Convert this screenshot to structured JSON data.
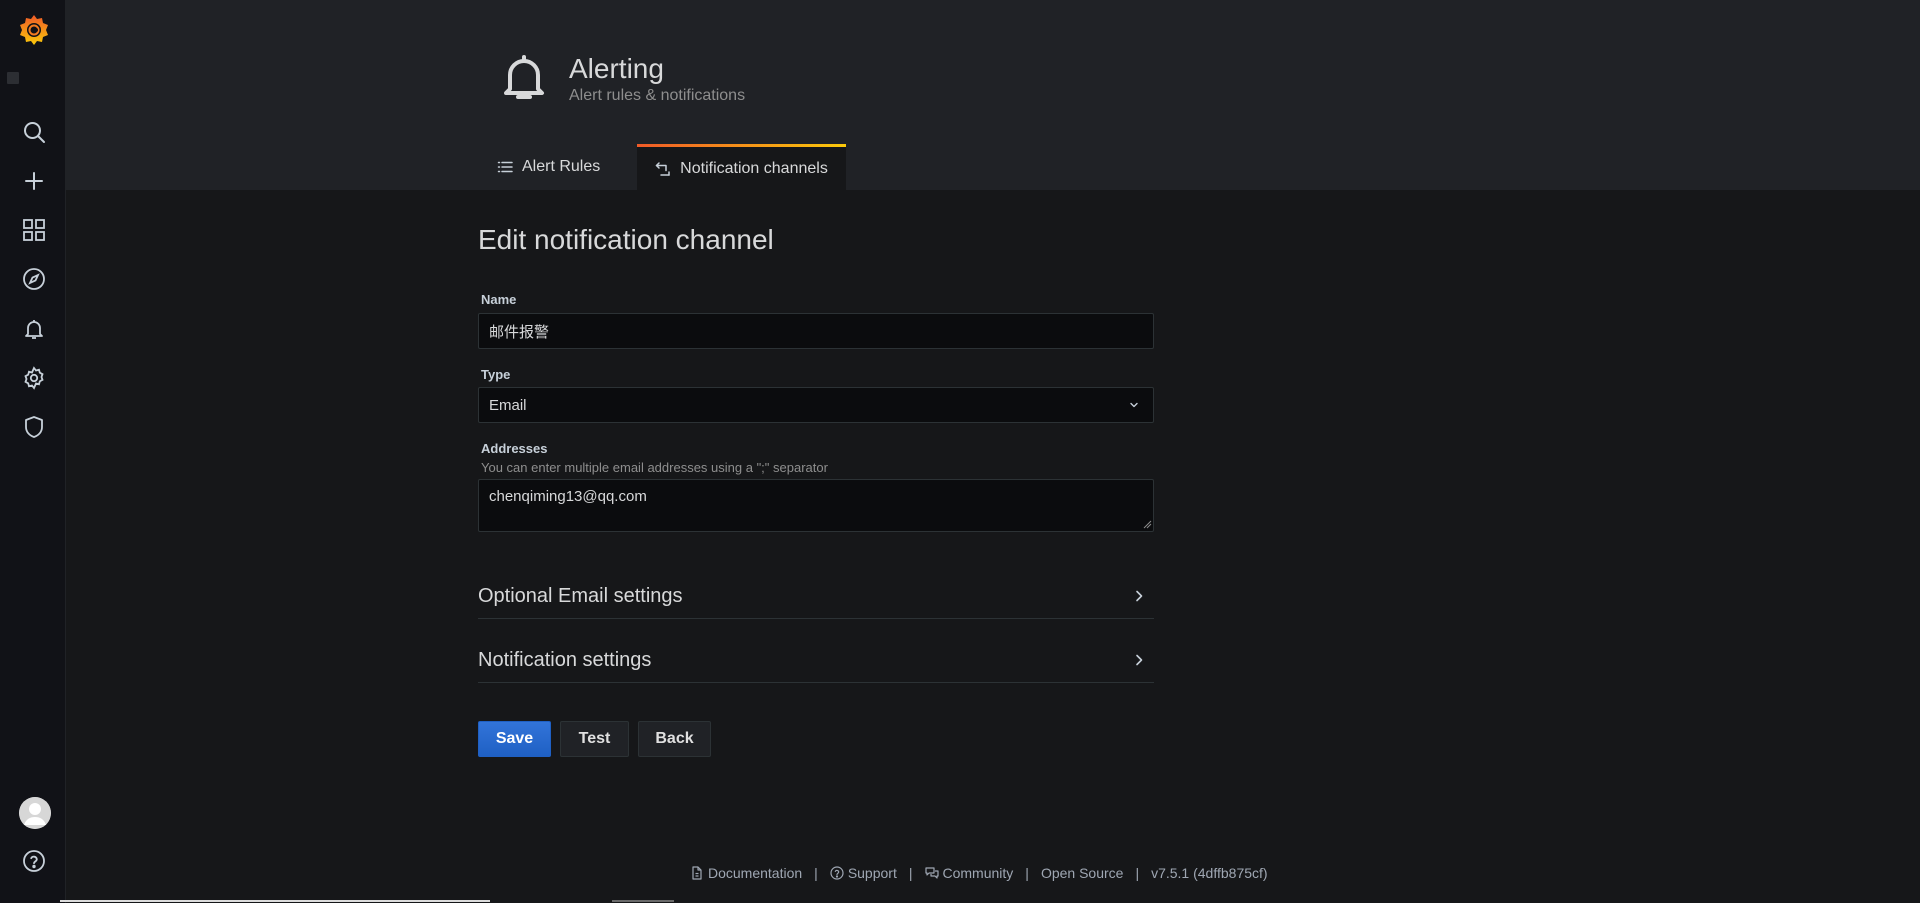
{
  "sidebar": {
    "logo": "grafana-logo",
    "items": [
      {
        "name": "search-icon",
        "label": "Search"
      },
      {
        "name": "plus-icon",
        "label": "Create"
      },
      {
        "name": "dashboards-icon",
        "label": "Dashboards"
      },
      {
        "name": "explore-compass-icon",
        "label": "Explore"
      },
      {
        "name": "bell-icon",
        "label": "Alerting"
      },
      {
        "name": "gear-icon",
        "label": "Configuration"
      },
      {
        "name": "shield-icon",
        "label": "Server Admin"
      }
    ],
    "bottom": [
      {
        "name": "avatar",
        "label": "User"
      },
      {
        "name": "help-icon",
        "label": "Help"
      }
    ]
  },
  "header": {
    "icon": "bell-icon",
    "title": "Alerting",
    "subtitle": "Alert rules & notifications",
    "tabs": [
      {
        "label": "Alert Rules",
        "icon": "list-icon",
        "active": false
      },
      {
        "label": "Notification channels",
        "icon": "channel-icon",
        "active": true
      }
    ]
  },
  "form": {
    "title": "Edit notification channel",
    "name_label": "Name",
    "name_value": "邮件报警",
    "type_label": "Type",
    "type_value": "Email",
    "addresses_label": "Addresses",
    "addresses_description": "You can enter multiple email addresses using a \";\" separator",
    "addresses_value": "chenqiming13@qq.com",
    "sections": [
      {
        "title": "Optional Email settings"
      },
      {
        "title": "Notification settings"
      }
    ],
    "buttons": {
      "save": "Save",
      "test": "Test",
      "back": "Back"
    }
  },
  "footer": {
    "links": [
      "Documentation",
      "Support",
      "Community",
      "Open Source"
    ],
    "version": "v7.5.1 (4dffb875cf)",
    "separator": "|"
  },
  "colors": {
    "background": "#161719",
    "sidebar": "#111217",
    "header": "#202226",
    "primary": "#3274d9",
    "tab_gradient_start": "#f05a28",
    "tab_gradient_end": "#fbca0a"
  }
}
